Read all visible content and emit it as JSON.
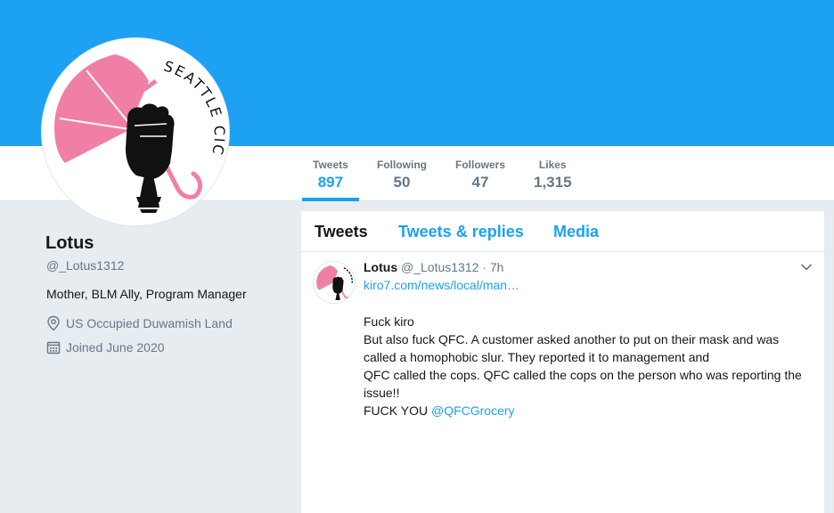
{
  "profile": {
    "avatar_text": "SEATTLE CIC",
    "name": "Lotus",
    "handle": "@_Lotus1312",
    "bio": "Mother, BLM Ally, Program Manager",
    "location": "US Occupied Duwamish Land",
    "joined": "Joined June 2020",
    "icons": {
      "location": "location-pin-icon",
      "joined": "calendar-icon"
    }
  },
  "stats": [
    {
      "label": "Tweets",
      "value": "897",
      "active": true
    },
    {
      "label": "Following",
      "value": "50"
    },
    {
      "label": "Followers",
      "value": "47"
    },
    {
      "label": "Likes",
      "value": "1,315"
    }
  ],
  "tabs": [
    {
      "label": "Tweets",
      "active": true
    },
    {
      "label": "Tweets & replies"
    },
    {
      "label": "Media"
    }
  ],
  "tweet": {
    "name": "Lotus",
    "handle": "@_Lotus1312",
    "separator": "·",
    "time": "7h",
    "link": "kiro7.com/news/local/man…",
    "lines": [
      "Fuck kiro",
      "But also fuck QFC. A customer asked another to put on their mask and was called a homophobic slur. They reported it to management and",
      "QFC called the cops. QFC called the cops on the person who was reporting the issue!!"
    ],
    "last_line_prefix": "FUCK YOU ",
    "mention": "@QFCGrocery"
  },
  "colors": {
    "banner": "#1da1f2",
    "accent": "#1da1f2",
    "umbrella": "#f07fa6",
    "page_bg": "#e6ecf0",
    "muted_text": "#657786"
  }
}
